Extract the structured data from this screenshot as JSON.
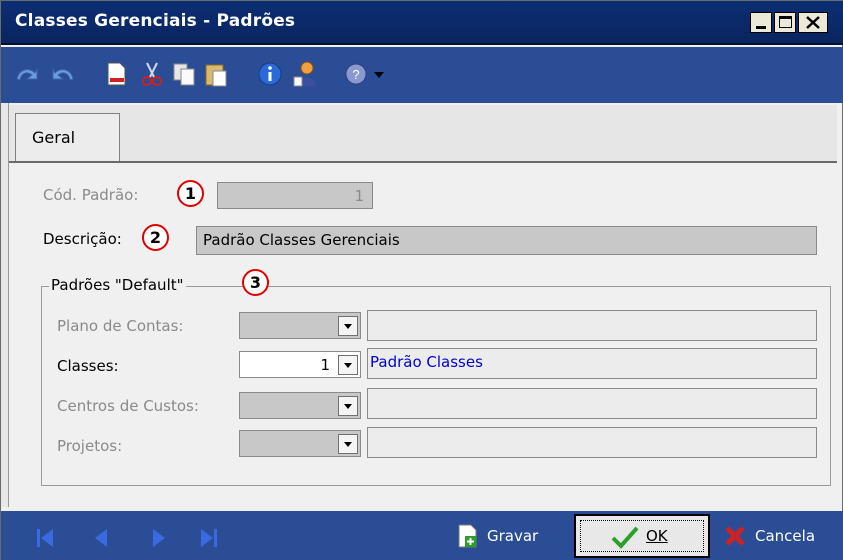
{
  "window": {
    "title": "Classes Gerenciais - Padrões"
  },
  "toolbar": {
    "icons": [
      "undo-icon",
      "redo-icon",
      "new-document-icon",
      "cut-icon",
      "copy-icon",
      "paste-icon",
      "info-icon",
      "user-icon",
      "help-icon",
      "dropdown-arrow-icon"
    ]
  },
  "tabs": [
    {
      "label": "Geral"
    }
  ],
  "form": {
    "cod_padrao": {
      "label": "Cód. Padrão:",
      "value": "1"
    },
    "descricao": {
      "label": "Descrição:",
      "value": "Padrão Classes Gerenciais"
    },
    "markers": [
      "1",
      "2",
      "3"
    ]
  },
  "defaults_group": {
    "title": "Padrões \"Default\"",
    "rows": [
      {
        "label": "Plano de Contas:",
        "value": "",
        "description": ""
      },
      {
        "label": "Classes:",
        "value": "1",
        "description": "Padrão Classes"
      },
      {
        "label": "Centros de Custos:",
        "value": "",
        "description": ""
      },
      {
        "label": "Projetos:",
        "value": "",
        "description": ""
      }
    ]
  },
  "footer": {
    "gravar": "Gravar",
    "ok": "OK",
    "cancela": "Cancela"
  },
  "colors": {
    "titlebar": "#0c2e74",
    "toolbar": "#2a4d95",
    "link_text": "#0000cc",
    "marker_ring": "#e00000"
  }
}
